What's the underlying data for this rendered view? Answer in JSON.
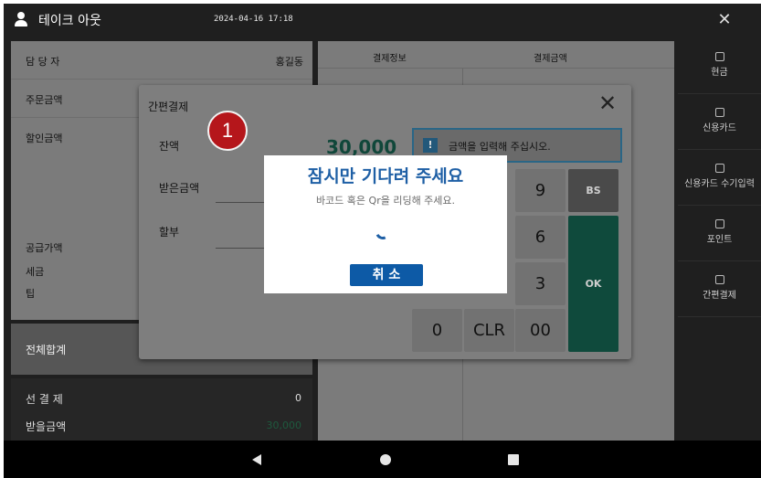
{
  "topbar": {
    "title": "테이크 아웃",
    "datetime": "2024-04-16 17:18",
    "close_glyph": "✕"
  },
  "left": {
    "staff_label": "담 당 자",
    "staff_value": "홍길동",
    "order_amount_label": "주문금액",
    "discount_label": "할인금액",
    "supply_label": "공급가액",
    "tax_label": "세금",
    "tip_label": "팁",
    "grand_total_label": "전체합계",
    "prepaid_label": "선 결 제",
    "prepaid_value": "0",
    "received_label": "받을금액",
    "received_value": "30,000"
  },
  "table": {
    "col1": "결제정보",
    "col2": "결제금액"
  },
  "side_menu": [
    {
      "label": "현금"
    },
    {
      "label": "신용카드"
    },
    {
      "label": "신용카드 수기입력"
    },
    {
      "label": "포인트"
    },
    {
      "label": "간편결제"
    }
  ],
  "dialog": {
    "title": "간편결제",
    "close_glyph": "✕",
    "balance_label": "잔액",
    "balance_value": "30,000",
    "received_label": "받은금액",
    "installment_label": "할부",
    "info_icon": "!",
    "message": "금액을 입력해 주십시오.",
    "keys": {
      "k9": "9",
      "k6": "6",
      "k3": "3",
      "k0": "0",
      "clr": "CLR",
      "k00": "00",
      "bs": "BS",
      "ok": "OK"
    }
  },
  "marker": "1",
  "wait_popup": {
    "title": "잠시만 기다려 주세요",
    "subtitle": "바코드 혹은 Qr을 리딩해 주세요.",
    "cancel_label": "취 소"
  },
  "colors": {
    "accent_blue": "#1e5fa5",
    "cancel_button": "#0d5aa6",
    "ok_green": "#0f4a3c",
    "marker_red": "#b5161b"
  }
}
